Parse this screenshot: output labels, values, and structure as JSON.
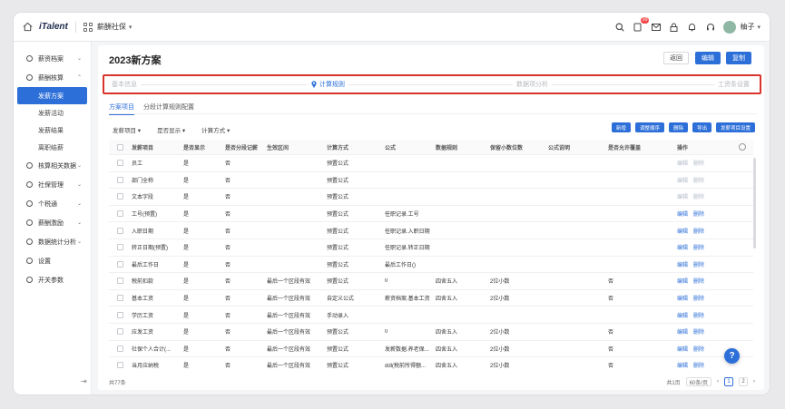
{
  "topbar": {
    "brand": "iTalent",
    "app_name": "薪酬社保",
    "app_caret": "▾",
    "message_badge": "99",
    "user_name": "柚子",
    "user_caret": "▾"
  },
  "sidebar": {
    "items": [
      {
        "label": "薪资档案",
        "chevron": "⌄"
      },
      {
        "label": "薪酬核算",
        "chevron": "⌃"
      },
      {
        "label": "核算相关数据",
        "chevron": "⌄"
      },
      {
        "label": "社保管理",
        "chevron": "⌄"
      },
      {
        "label": "个税通",
        "chevron": "⌄"
      },
      {
        "label": "薪酬激励",
        "chevron": "⌄"
      },
      {
        "label": "数据统计分析",
        "chevron": "⌄"
      },
      {
        "label": "设置",
        "chevron": ""
      },
      {
        "label": "开关参数",
        "chevron": ""
      }
    ],
    "sub_items": [
      "发薪方案",
      "发薪活动",
      "发薪结果",
      "离职结薪"
    ],
    "collapse_glyph": "⇥"
  },
  "page": {
    "title": "2023新方案",
    "back_label": "返回",
    "edit_label": "编辑",
    "copy_label": "复制"
  },
  "steps": [
    "基本信息",
    "计算规则",
    "数据项分析",
    "工资条设置"
  ],
  "tabs": [
    "方案项目",
    "分段计算规则配置"
  ],
  "filters": [
    "发薪项目 ▾",
    "是否显示 ▾",
    "计算方式 ▾"
  ],
  "toolbar": [
    "新增",
    "调整顺序",
    "删除",
    "导出",
    "发薪项目设置"
  ],
  "table": {
    "headers": [
      "发薪项目",
      "是否显示",
      "是否分段记薪",
      "生效区间",
      "计算方式",
      "公式",
      "数据规则",
      "保留小数位数",
      "公式说明",
      "是否允许覆盖",
      "操作"
    ],
    "rows": [
      [
        "员工",
        "是",
        "否",
        "",
        "预置公式",
        "",
        "",
        "",
        "",
        "",
        "编辑",
        "删除"
      ],
      [
        "部门全称",
        "是",
        "否",
        "",
        "预置公式",
        "",
        "",
        "",
        "",
        "",
        "编辑",
        "删除"
      ],
      [
        "文本字段",
        "是",
        "否",
        "",
        "预置公式",
        "",
        "",
        "",
        "",
        "",
        "编辑",
        "删除"
      ],
      [
        "工号(预置)",
        "是",
        "否",
        "",
        "预置公式",
        "任职记录.工号",
        "",
        "",
        "",
        "",
        "编辑",
        "删除"
      ],
      [
        "入职日期",
        "是",
        "否",
        "",
        "预置公式",
        "任职记录.入职日期",
        "",
        "",
        "",
        "",
        "编辑",
        "删除"
      ],
      [
        "转正日期(预置)",
        "是",
        "否",
        "",
        "预置公式",
        "任职记录.转正日期",
        "",
        "",
        "",
        "",
        "编辑",
        "删除"
      ],
      [
        "最后工作日",
        "是",
        "否",
        "",
        "预置公式",
        "最后工作日()",
        "",
        "",
        "",
        "",
        "编辑",
        "删除"
      ],
      [
        "税前扣款",
        "是",
        "否",
        "最后一个区段有效",
        "预置公式",
        "0",
        "四舍五入",
        "2位小数",
        "",
        "否",
        "编辑",
        "删除"
      ],
      [
        "基本工资",
        "是",
        "否",
        "最后一个区段有效",
        "自定义公式",
        "薪资档案.基本工资",
        "四舍五入",
        "2位小数",
        "",
        "否",
        "编辑",
        "删除"
      ],
      [
        "学历工资",
        "是",
        "否",
        "最后一个区段有效",
        "手动录入",
        "",
        "",
        "",
        "",
        "",
        "编辑",
        "删除"
      ],
      [
        "应发工资",
        "是",
        "否",
        "最后一个区段有效",
        "预置公式",
        "0",
        "四舍五入",
        "2位小数",
        "",
        "否",
        "编辑",
        "删除"
      ],
      [
        "社保个人合计(...",
        "是",
        "否",
        "最后一个区段有效",
        "预置公式",
        "发薪数据.养老保...",
        "四舍五入",
        "2位小数",
        "",
        "否",
        "编辑",
        "删除"
      ],
      [
        "当月应纳税",
        "是",
        "否",
        "最后一个区段有效",
        "预置公式",
        "ddl(税前所得额...",
        "四舍五入",
        "2位小数",
        "",
        "否",
        "编辑",
        "删除"
      ]
    ]
  },
  "footer": {
    "left": "共77条",
    "total": "共1页",
    "page_size": "60条/页",
    "prev": "‹",
    "pages": [
      "1",
      "2"
    ],
    "next": "›"
  },
  "help_label": "?"
}
